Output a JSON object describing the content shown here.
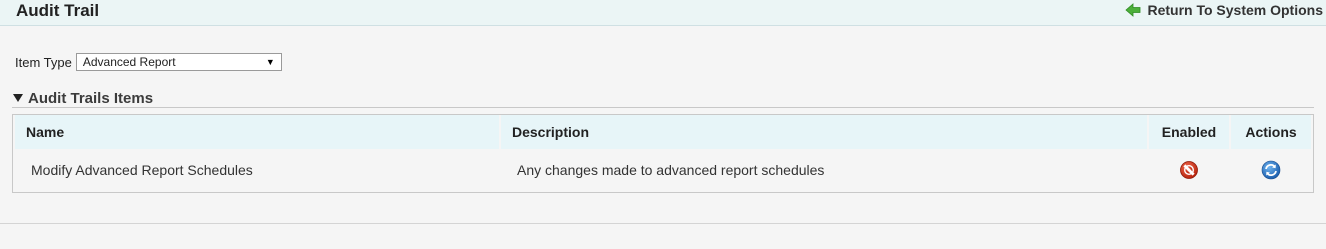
{
  "header": {
    "title": "Audit Trail",
    "return_link": "Return To System Options",
    "return_icon": "green-back-arrow-icon"
  },
  "filter": {
    "label": "Item Type",
    "selected": "Advanced Report"
  },
  "section": {
    "title": "Audit Trails Items"
  },
  "table": {
    "columns": [
      "Name",
      "Description",
      "Enabled",
      "Actions"
    ],
    "rows": [
      {
        "name": "Modify Advanced Report Schedules",
        "description": "Any changes made to advanced report schedules",
        "enabled_icon": "disabled-icon",
        "action_icon": "refresh-icon"
      }
    ]
  },
  "colors": {
    "header_bg": "#ebf5f5",
    "table_header_bg": "#e7f5f8",
    "disabled_red": "#d23a1e",
    "refresh_blue": "#2f7fd0",
    "arrow_green": "#4caf3a"
  }
}
